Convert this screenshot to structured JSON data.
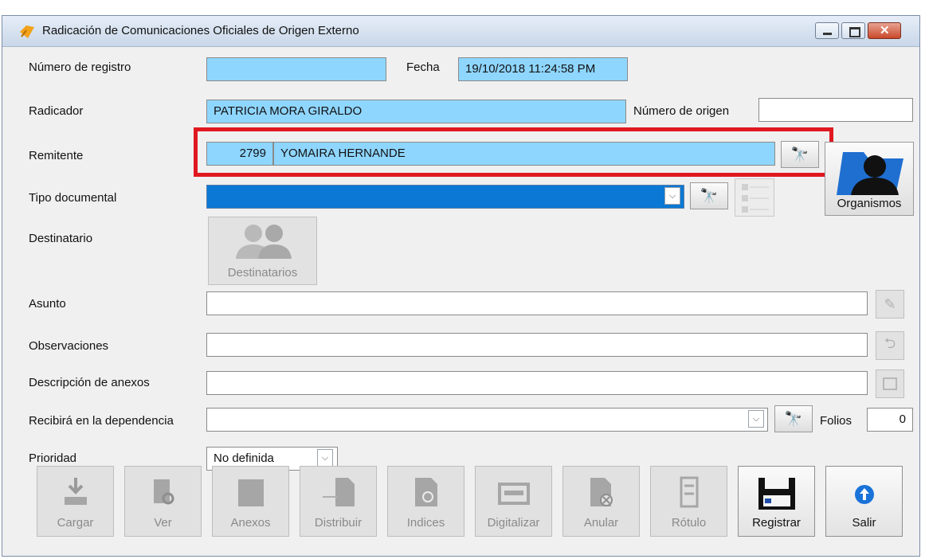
{
  "window": {
    "title": "Radicación de Comunicaciones Oficiales de Origen Externo"
  },
  "form": {
    "numero_registro": {
      "label": "Número de registro",
      "value": ""
    },
    "fecha": {
      "label": "Fecha",
      "value": "19/10/2018 11:24:58 PM"
    },
    "radicador": {
      "label": "Radicador",
      "value": "PATRICIA MORA GIRALDO"
    },
    "numero_origen": {
      "label": "Número de origen",
      "value": ""
    },
    "remitente": {
      "label": "Remitente",
      "code": "2799",
      "name": "YOMAIRA HERNANDE"
    },
    "tipo_documental": {
      "label": "Tipo documental",
      "value": ""
    },
    "destinatario": {
      "label": "Destinatario",
      "button": "Destinatarios"
    },
    "organismos": {
      "button": "Organismos"
    },
    "asunto": {
      "label": "Asunto",
      "value": ""
    },
    "observaciones": {
      "label": "Observaciones",
      "value": ""
    },
    "descripcion_anexos": {
      "label": "Descripción de anexos",
      "value": ""
    },
    "recibira": {
      "label": "Recibirá en la dependencia",
      "value": ""
    },
    "folios": {
      "label": "Folios",
      "value": "0"
    },
    "prioridad": {
      "label": "Prioridad",
      "value": "No definida"
    }
  },
  "toolbar": {
    "cargar": "Cargar",
    "ver": "Ver",
    "anexos": "Anexos",
    "distribuir": "Distribuir",
    "indices": "Indices",
    "digitalizar": "Digitalizar",
    "anular": "Anular",
    "rotulo": "Rótulo",
    "registrar": "Registrar",
    "salir": "Salir"
  },
  "colors": {
    "field_blue": "#8fd6ff",
    "selected_blue": "#0a78d4",
    "highlight_red": "#e01820"
  }
}
